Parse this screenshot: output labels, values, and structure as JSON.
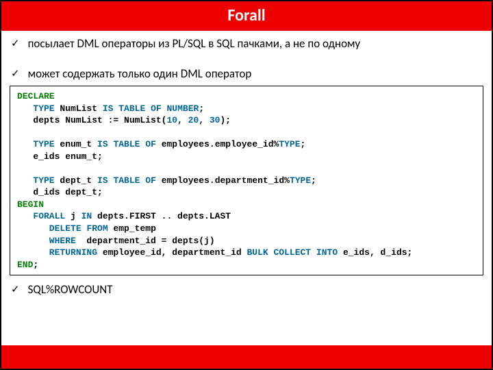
{
  "header": {
    "title": "Forall"
  },
  "bullets": {
    "b1": "посылает DML операторы из PL/SQL в SQL пачками, а не по одному",
    "b2": "может содержать только один DML оператор",
    "b3": "SQL%ROWCOUNT"
  },
  "code": {
    "l01a": "DECLARE",
    "l02a": "   TYPE",
    "l02b": " NumList ",
    "l02c": "IS",
    "l02d": " ",
    "l02e": "TABLE",
    "l02f": " ",
    "l02g": "OF",
    "l02h": " ",
    "l02i": "NUMBER",
    "l02j": ";",
    "l03a": "   depts NumList := NumList(",
    "l03b": "10",
    "l03c": ", ",
    "l03d": "20",
    "l03e": ", ",
    "l03f": "30",
    "l03g": ");",
    "l05a": "   TYPE",
    "l05b": " enum_t ",
    "l05c": "IS",
    "l05d": " ",
    "l05e": "TABLE",
    "l05f": " ",
    "l05g": "OF",
    "l05h": " employees.employee_id%",
    "l05i": "TYPE",
    "l05j": ";",
    "l06a": "   e_ids enum_t;",
    "l08a": "   TYPE",
    "l08b": " dept_t ",
    "l08c": "IS",
    "l08d": " ",
    "l08e": "TABLE",
    "l08f": " ",
    "l08g": "OF",
    "l08h": " employees.department_id%",
    "l08i": "TYPE",
    "l08j": ";",
    "l09a": "   d_ids dept_t;",
    "l10a": "BEGIN",
    "l11a": "   FORALL",
    "l11b": " j ",
    "l11c": "IN",
    "l11d": " depts.FIRST .. depts.LAST",
    "l12a": "      DELETE",
    "l12b": " ",
    "l12c": "FROM",
    "l12d": " emp_temp",
    "l13a": "      WHERE",
    "l13b": "  department_id = depts(j)",
    "l14a": "      RETURNING",
    "l14b": " employee_id, department_id ",
    "l14c": "BULK",
    "l14d": " ",
    "l14e": "COLLECT",
    "l14f": " ",
    "l14g": "INTO",
    "l14h": " e_ids, d_ids;",
    "l15a": "END",
    "l15b": ";"
  }
}
